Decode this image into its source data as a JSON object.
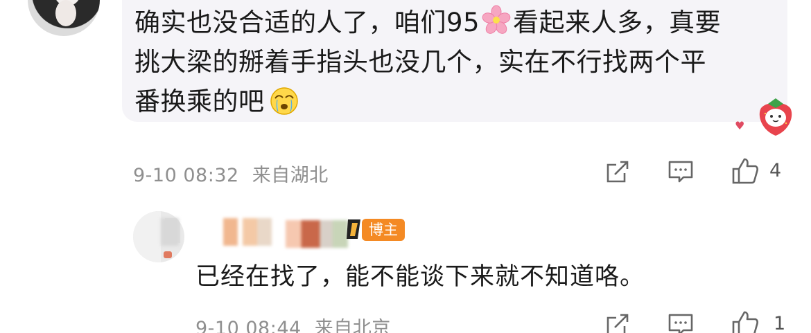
{
  "comment": {
    "line1_a": "确实也没合适的人了，咱们95",
    "line1_b": "看起来人多，真要",
    "line2": "挑大梁的掰着手指头也没几个，实在不行找两个平",
    "line3": "番换乘的吧",
    "emojis": [
      "cherry-blossom-icon",
      "crying-face-icon"
    ],
    "time": "9-10 08:32",
    "location": "来自湖北",
    "likes": "4"
  },
  "reply": {
    "badge": "博主",
    "text": "已经在找了，能不能谈下来就不知道咯。",
    "time": "9-10 08:44",
    "location": "来自北京",
    "likes": "1"
  },
  "icons": [
    "share-icon",
    "comment-icon",
    "like-icon",
    "strawberry-sticker-icon",
    "vip-icon"
  ],
  "colors": {
    "badge": "#f48a24",
    "meta_text": "#8f8f8f",
    "bubble_bg": "#f5f4f8"
  }
}
